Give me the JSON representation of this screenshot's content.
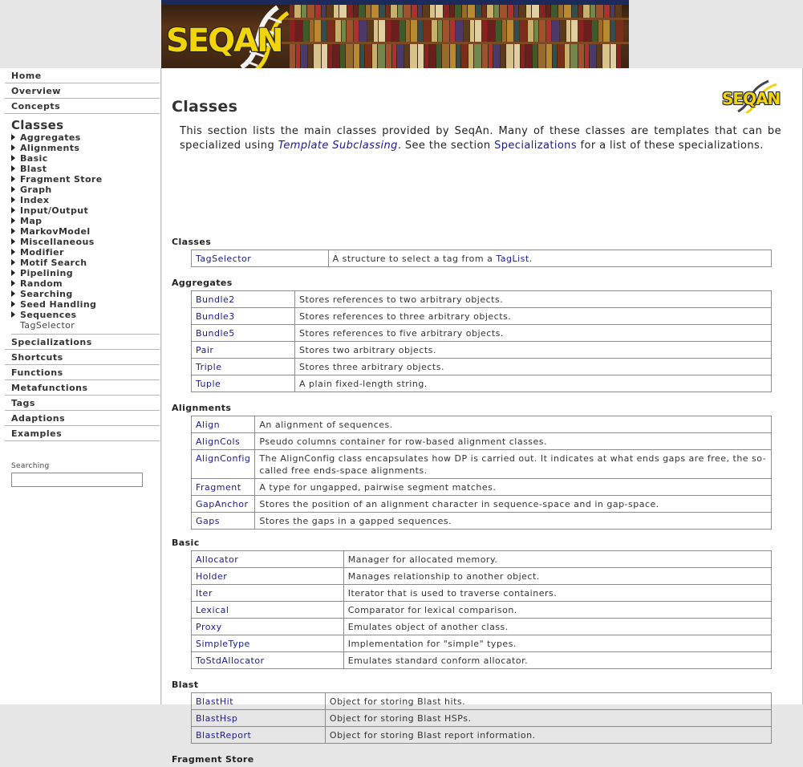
{
  "banner": {
    "logo_text": "SEQAN"
  },
  "sidebar": {
    "top_links": [
      "Home",
      "Overview",
      "Concepts"
    ],
    "current_heading": "Classes",
    "sub_items": [
      "Aggregates",
      "Alignments",
      "Basic",
      "Blast",
      "Fragment Store",
      "Graph",
      "Index",
      "Input/Output",
      "Map",
      "MarkovModel",
      "Miscellaneous",
      "Modifier",
      "Motif Search",
      "Pipelining",
      "Random",
      "Searching",
      "Seed Handling",
      "Sequences"
    ],
    "leaf_item": "TagSelector",
    "bottom_links": [
      "Specializations",
      "Shortcuts",
      "Functions",
      "Metafunctions",
      "Tags",
      "Adaptions",
      "Examples"
    ],
    "search_label": "Searching",
    "search_value": ""
  },
  "main": {
    "logo_text": "SEQAN",
    "title": "Classes",
    "intro": {
      "part1": "This section lists the main classes provided by SeqAn. Many of these classes are templates that can be specialized using ",
      "link1": "Template Subclassing",
      "part2": ". See the section ",
      "link2": "Specializations",
      "part3": " for a list of these specializations."
    },
    "sections": [
      {
        "title": "Classes",
        "rows": [
          {
            "name": "TagSelector",
            "desc": "A structure to select a tag from a ",
            "desc_link": "TagList",
            "desc_after": "."
          }
        ]
      },
      {
        "title": "Aggregates",
        "rows": [
          {
            "name": "Bundle2",
            "desc": "Stores references to two arbitrary objects."
          },
          {
            "name": "Bundle3",
            "desc": "Stores references to three arbitrary objects."
          },
          {
            "name": "Bundle5",
            "desc": "Stores references to five arbitrary objects."
          },
          {
            "name": "Pair",
            "desc": "Stores two arbitrary objects."
          },
          {
            "name": "Triple",
            "desc": "Stores three arbitrary objects."
          },
          {
            "name": "Tuple",
            "desc": "A plain fixed-length string."
          }
        ]
      },
      {
        "title": "Alignments",
        "rows": [
          {
            "name": "Align",
            "desc": "An alignment of sequences."
          },
          {
            "name": "AlignCols",
            "desc": "Pseudo columns container for row-based alignment classes."
          },
          {
            "name": "AlignConfig",
            "desc": "The AlignConfig class encapsulates how DP is carried out. It indicates at what ends gaps are free, the so-called free ends-space alignments."
          },
          {
            "name": "Fragment",
            "desc": "A type for ungapped, pairwise segment matches."
          },
          {
            "name": "GapAnchor",
            "desc": "Stores the position of an alignment character in sequence-space and in gap-space."
          },
          {
            "name": "Gaps",
            "desc": "Stores the gaps in a gapped sequences."
          }
        ]
      },
      {
        "title": "Basic",
        "rows": [
          {
            "name": "Allocator",
            "desc": "Manager for allocated memory."
          },
          {
            "name": "Holder",
            "desc": "Manages relationship to another object."
          },
          {
            "name": "Iter",
            "desc": "Iterator that is used to traverse containers."
          },
          {
            "name": "Lexical",
            "desc": "Comparator for lexical comparison."
          },
          {
            "name": "Proxy",
            "desc": "Emulates object of another class."
          },
          {
            "name": "SimpleType",
            "desc": "Implementation for \"simple\" types."
          },
          {
            "name": "ToStdAllocator",
            "desc": "Emulates standard conform allocator."
          }
        ]
      },
      {
        "title": "Blast",
        "rows": [
          {
            "name": "BlastHit",
            "desc": "Object for storing Blast hits."
          },
          {
            "name": "BlastHsp",
            "desc": "Object for storing Blast HSPs."
          },
          {
            "name": "BlastReport",
            "desc": "Object for storing Blast report information."
          }
        ]
      },
      {
        "title": "Fragment Store",
        "rows": []
      }
    ]
  }
}
